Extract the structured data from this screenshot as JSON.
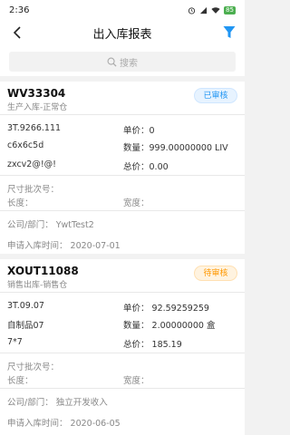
{
  "status": {
    "time": "2:36",
    "battery": "85"
  },
  "header": {
    "title": "出入库报表"
  },
  "search": {
    "placeholder": "搜索"
  },
  "orders": [
    {
      "code": "WV33304",
      "type": "生产入库-正常仓",
      "status": "已审核",
      "left": [
        "3T.9266.111",
        "c6x6c5d",
        "zxcv2@!@!"
      ],
      "right": [
        "单价：0",
        "数量：999.00000000 LIV",
        "总价：0.00"
      ],
      "batch": "尺寸批次号：",
      "length": "长度：",
      "width": "宽度：",
      "dept": "公司/部门：  YwtTest2",
      "date": "申请入库时间：  2020-07-01"
    },
    {
      "code": "XOUT11088",
      "type": "销售出库-销售仓",
      "status": "待审核",
      "left": [
        "3T.09.07",
        "自制品07",
        "7*7"
      ],
      "right": [
        "单价：  92.59259259",
        "数量：  2.00000000 盒",
        "总价：  185.19"
      ],
      "batch": "尺寸批次号：",
      "length": "长度：",
      "width": "宽度：",
      "dept": "公司/部门：  独立开发收入",
      "date": "申请入库时间：  2020-06-05"
    }
  ],
  "colors": {
    "accent": "#2196f3",
    "pending": "#ff9800"
  }
}
